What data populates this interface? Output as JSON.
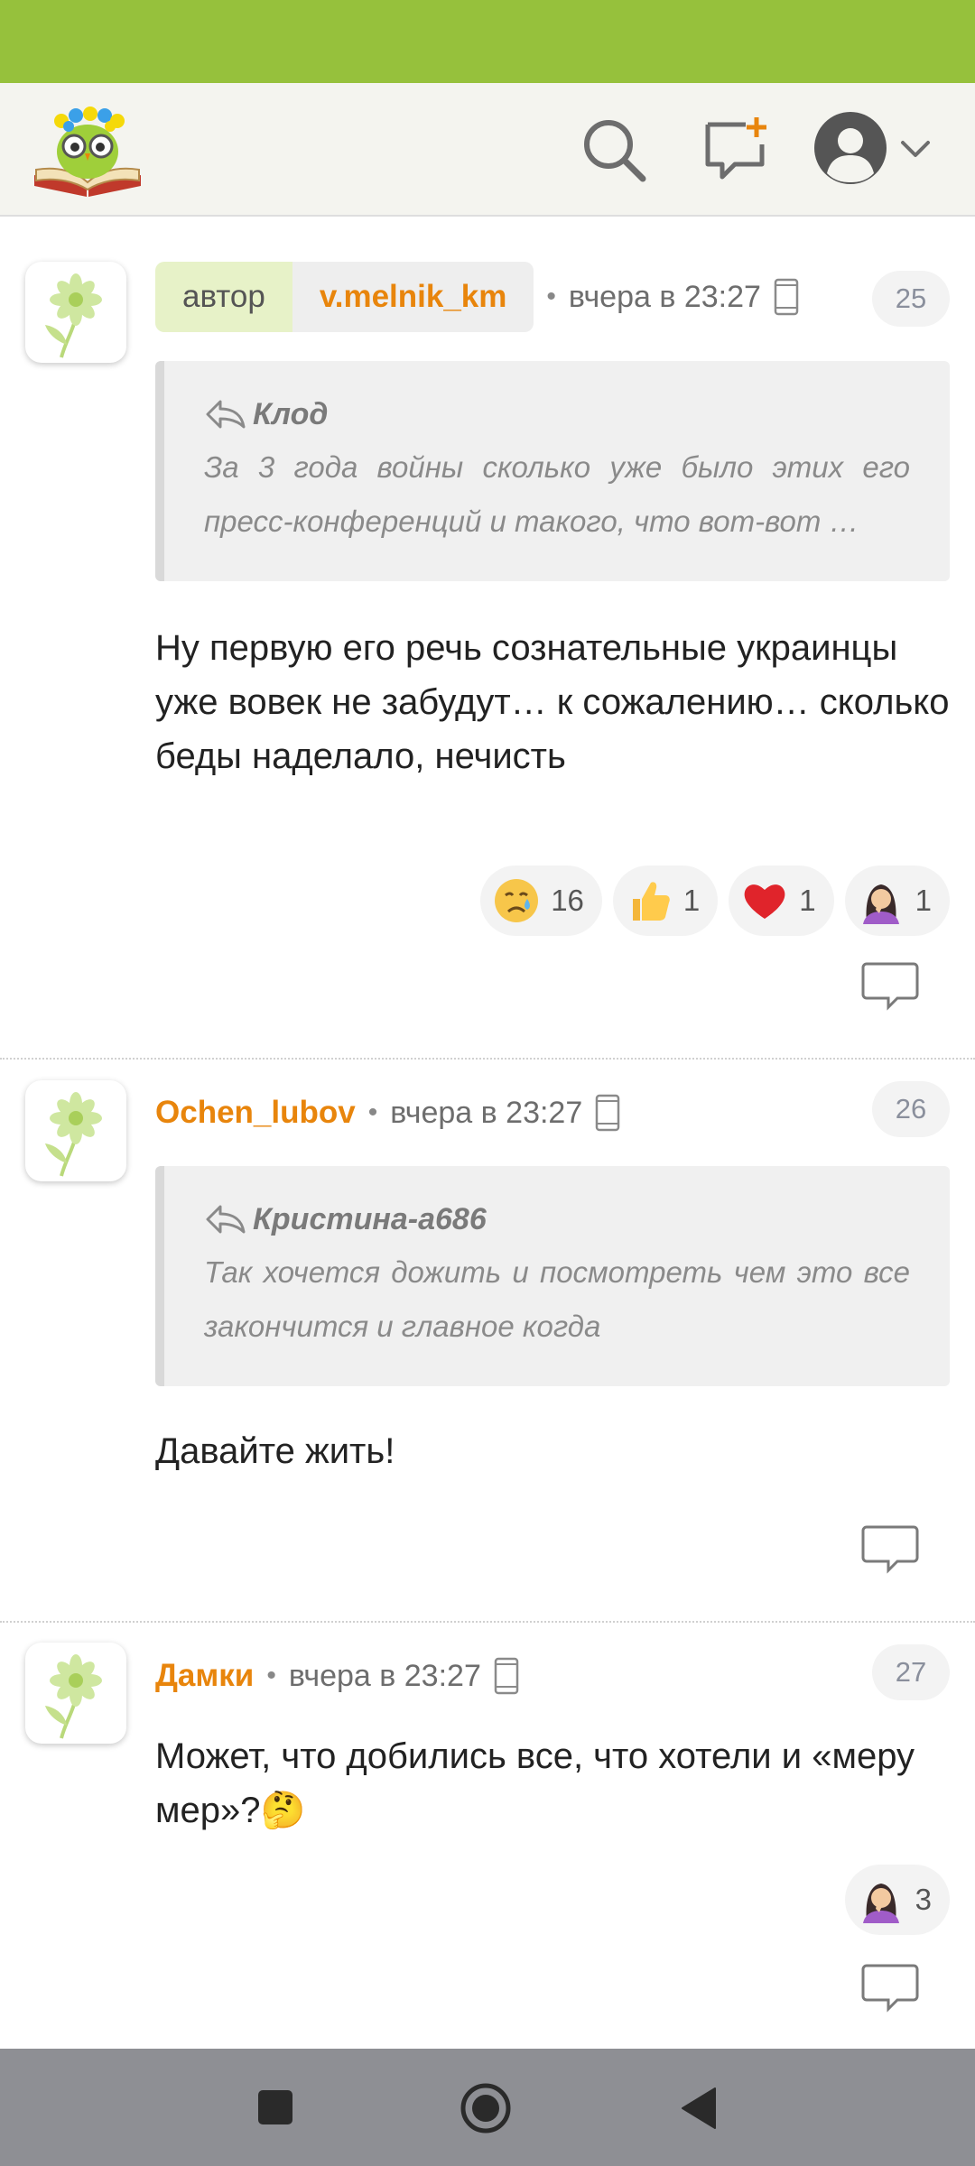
{
  "comments": [
    {
      "author_tag": "автор",
      "author": "v.melnik_km",
      "separator": "•",
      "time": "вчера в 23:27",
      "number": "25",
      "quote": {
        "author": "Клод",
        "text": "За 3 года войны сколько уже было этих его пресс-конференций и такого, что вот-вот …"
      },
      "text": "Ну первую его речь сознательные украинцы уже вовек не забудут… к сожалению… сколько беды наделало, нечисть",
      "reactions": [
        {
          "icon": "crying-face-icon",
          "count": "16"
        },
        {
          "icon": "thumbs-up-icon",
          "count": "1"
        },
        {
          "icon": "red-heart-icon",
          "count": "1"
        },
        {
          "icon": "woman-facepalming-icon",
          "count": "1"
        }
      ]
    },
    {
      "author": "Ochen_lubov",
      "separator": "•",
      "time": "вчера в 23:27",
      "number": "26",
      "quote": {
        "author": "Кристина-а686",
        "text": "Так хочется дожить и посмотреть чем это все закончится и главное когда"
      },
      "text": "Давайте жить!"
    },
    {
      "author": "Дамки",
      "separator": "•",
      "time": "вчера в 23:27",
      "number": "27",
      "text": "Может, что добились все, что хотели и «меру мер»?🤔",
      "reactions": [
        {
          "icon": "woman-facepalming-icon",
          "count": "3"
        }
      ]
    }
  ],
  "colors": {
    "status_bar": "#96c13c",
    "header_bg": "#f4f4ef",
    "nickname": "#e8850c",
    "author_tag_bg": "#e7f2c8",
    "nav_bar": "#8e8f94"
  },
  "icons": {
    "logo": "owl-book-logo-icon",
    "search": "search-icon",
    "new_post": "new-post-icon",
    "profile": "user-avatar-icon",
    "caret": "chevron-down-icon",
    "device": "phone-icon",
    "reply": "comment-reply-icon",
    "quote": "reply-arrow-icon",
    "nav_recent": "square-icon",
    "nav_home": "circle-icon",
    "nav_back": "triangle-back-icon"
  }
}
